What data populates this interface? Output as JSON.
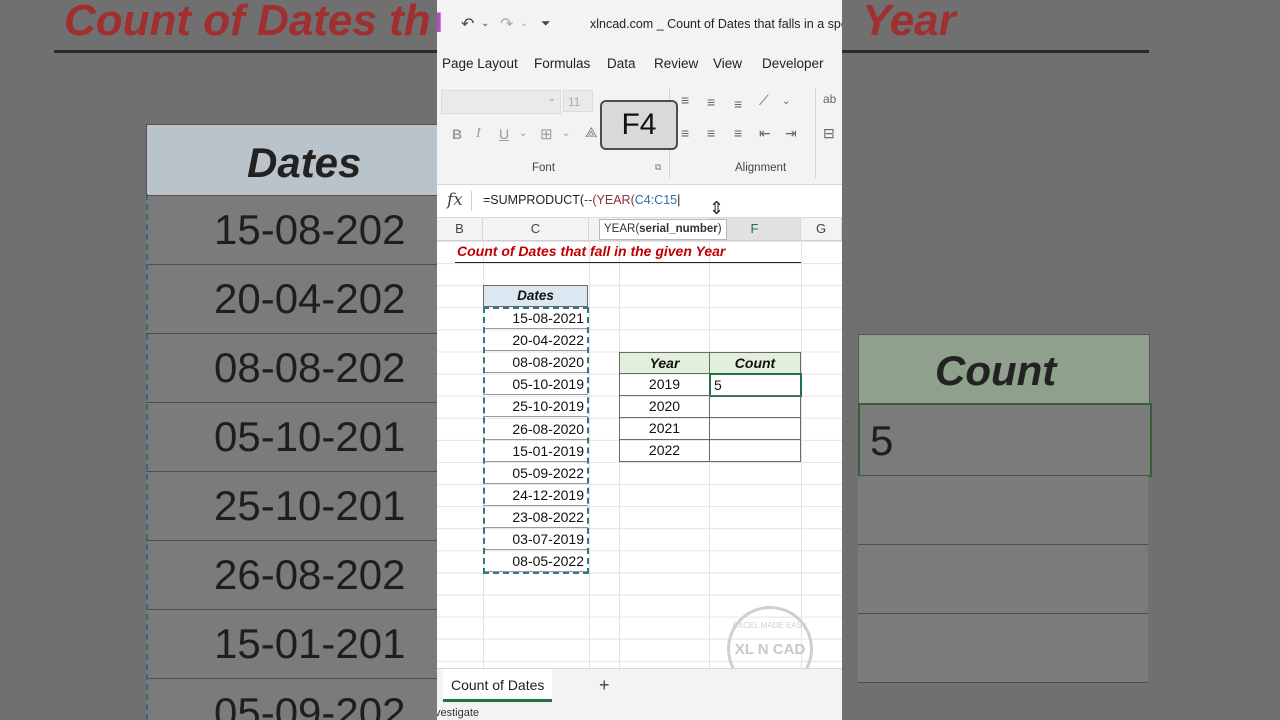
{
  "window": {
    "title": "xlncad.com _ Count of Dates that falls in a speci",
    "undo_icon": "undo-icon",
    "redo_icon": "redo-icon"
  },
  "menu": [
    "Page Layout",
    "Formulas",
    "Data",
    "Review",
    "View",
    "Developer"
  ],
  "ribbon": {
    "font_size": "11",
    "font_group_label": "Font",
    "alignment_group_label": "Alignment",
    "bold": "B",
    "italic": "I",
    "underline": "U"
  },
  "key_overlay": "F4",
  "formula_bar": {
    "fx": "fx",
    "part1": "=SUMPRODUCT(",
    "part2": "--(YEAR(",
    "part3": "C4:C15"
  },
  "tooltip": {
    "fn": "YEAR(",
    "arg": "serial_number",
    "close": ")"
  },
  "columns": [
    "B",
    "C",
    "",
    "",
    "F",
    "G"
  ],
  "sheet": {
    "title": "Count of Dates that fall in the given Year",
    "dates_header": "Dates",
    "dates": [
      "15-08-2021",
      "20-04-2022",
      "08-08-2020",
      "05-10-2019",
      "25-10-2019",
      "26-08-2020",
      "15-01-2019",
      "05-09-2022",
      "24-12-2019",
      "23-08-2022",
      "03-07-2019",
      "08-05-2022"
    ],
    "year_header": "Year",
    "count_header": "Count",
    "years": [
      "2019",
      "2020",
      "2021",
      "2022"
    ],
    "counts": [
      "5",
      "",
      "",
      ""
    ]
  },
  "tabs": {
    "active": "Count of Dates",
    "add": "+"
  },
  "status": "vestigate",
  "background": {
    "title_left": "Count of Dates th",
    "title_right": "Year",
    "dates_header": "Dates",
    "dates": [
      "15-08-202",
      "20-04-202",
      "08-08-202",
      "05-10-201",
      "25-10-201",
      "26-08-202",
      "15-01-201",
      "05-09-202"
    ],
    "count_header": "Count",
    "count_value": "5"
  },
  "watermark": {
    "brand": "XL N CAD",
    "top": "EXCEL MADE EASY"
  }
}
